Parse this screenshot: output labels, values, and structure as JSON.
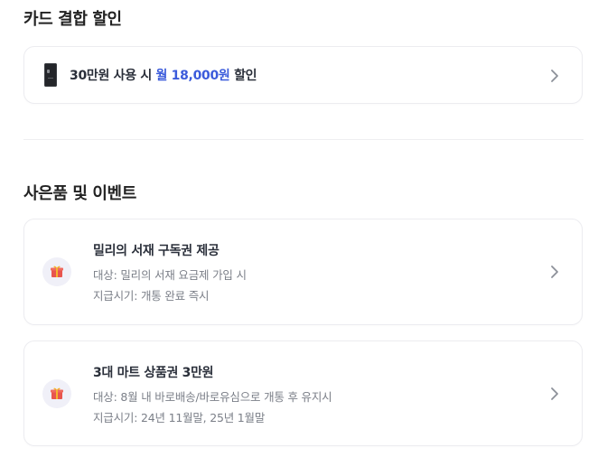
{
  "card_combo": {
    "title": "카드 결합 할인",
    "item": {
      "prefix": "30만원 사용 시",
      "amount": "월 18,000원",
      "suffix": "할인"
    }
  },
  "gifts": {
    "title": "사은품 및 이벤트",
    "items": [
      {
        "title": "밀리의 서재 구독권 제공",
        "target": "대상: 밀리의 서재 요금제 가입 시",
        "payout": "지급시기: 개통 완료 즉시"
      },
      {
        "title": "3대 마트 상품권 3만원",
        "target": "대상: 8월 내 바로배송/바로유심으로 개통 후 유지시",
        "payout": "지급시기: 24년 11월말, 25년 1월말"
      }
    ]
  },
  "icons": {
    "card": "card-thumbnail-icon",
    "chevron": "chevron-right-icon",
    "gift": "gift-icon"
  },
  "colors": {
    "accent": "#3b5bdb",
    "gift_red": "#e8554e",
    "gift_yellow": "#f5b52e",
    "badge_bg": "#f0f0f8",
    "border": "#ececf0"
  }
}
